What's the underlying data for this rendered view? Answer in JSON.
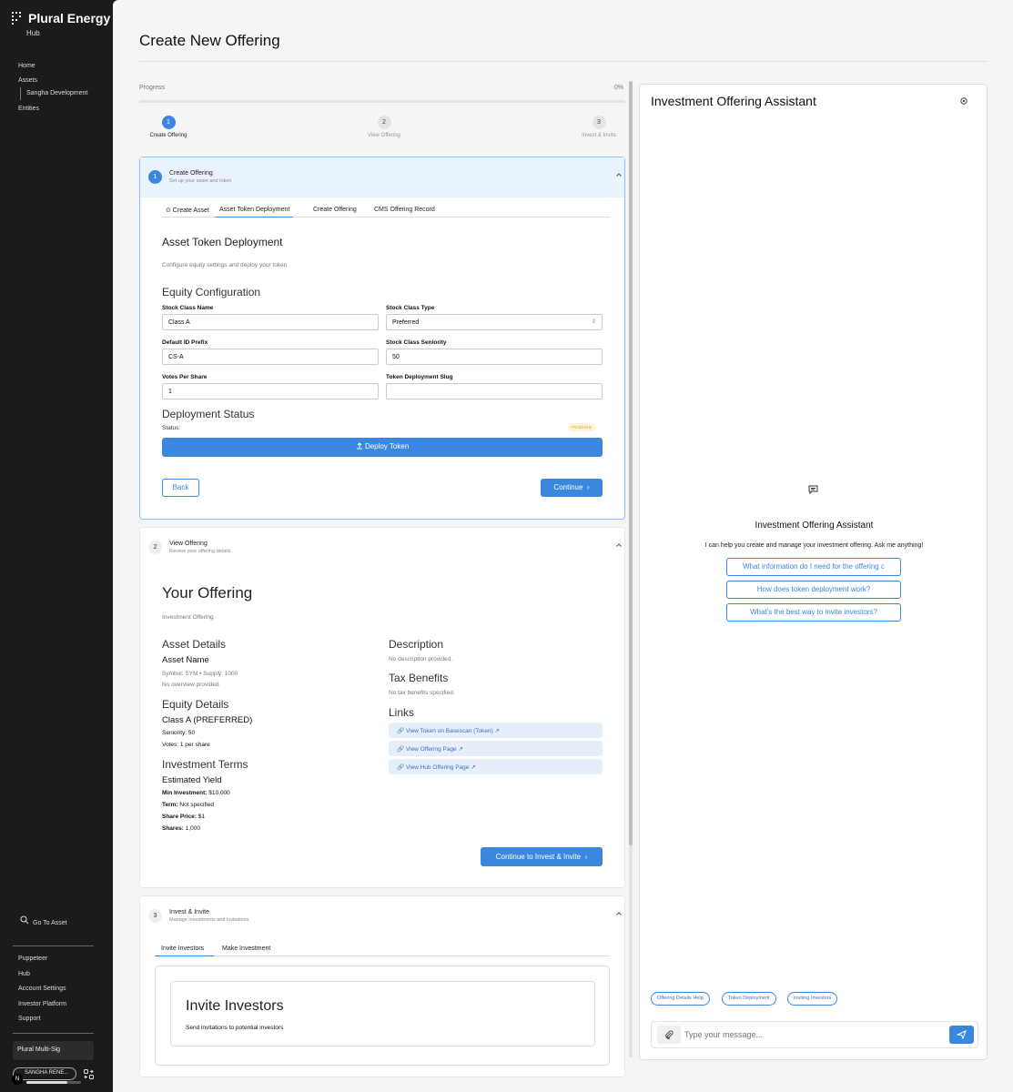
{
  "sidebar": {
    "brand": "Plural Energy",
    "brand_sub": "Hub",
    "nav": {
      "home": "Home",
      "assets": "Assets",
      "asset_child": "Sangha Development",
      "entities": "Entities"
    },
    "goto_asset": "Go To Asset",
    "links": [
      "Puppeteer",
      "Hub",
      "Account Settings",
      "Investor Platform",
      "Support"
    ],
    "multisig": "Plural Multi-Sig",
    "account_initial": "N",
    "account_label": "SANGHA RENE..."
  },
  "page": {
    "title": "Create New Offering"
  },
  "progress": {
    "label": "Progress",
    "percent_text": "0%",
    "fraction": 0
  },
  "steps": [
    {
      "num": "1",
      "label": "Create Offering"
    },
    {
      "num": "2",
      "label": "View Offering"
    },
    {
      "num": "3",
      "label": "Invest & Invite"
    }
  ],
  "section1": {
    "num": "1",
    "title": "Create Offering",
    "subtitle": "Set up your asset and token",
    "tabs": [
      "⊙ Create Asset",
      "Asset Token Deployment",
      "Create Offering",
      "CMS Offering Record"
    ],
    "heading": "Asset Token Deployment",
    "description": "Configure equity settings and deploy your token",
    "equity_heading": "Equity Configuration",
    "fields": {
      "stock_class_name": {
        "label": "Stock Class Name",
        "value": "Class A"
      },
      "stock_class_type": {
        "label": "Stock Class Type",
        "value": "Preferred"
      },
      "default_id_prefix": {
        "label": "Default ID Prefix",
        "value": "CS-A"
      },
      "stock_class_seniority": {
        "label": "Stock Class Seniority",
        "value": "50"
      },
      "votes_per_share": {
        "label": "Votes Per Share",
        "value": "1"
      },
      "token_deployment_slug": {
        "label": "Token Deployment Slug",
        "value": ""
      }
    },
    "deployment_heading": "Deployment Status",
    "status_label": "Status:",
    "status_badge": "PENDING",
    "deploy_button": "Deploy Token",
    "back_button": "Back",
    "continue_button": "Continue"
  },
  "section2": {
    "num": "2",
    "title": "View Offering",
    "subtitle": "Review your offering details",
    "heading": "Your Offering",
    "kind": "Investment Offering",
    "asset_details_heading": "Asset Details",
    "asset_name": "Asset Name",
    "asset_symbol_line": "Symbol: SYM • Supply: 1000",
    "asset_overview": "No overview provided.",
    "equity_heading": "Equity Details",
    "equity_class": "Class A (PREFERRED)",
    "seniority": "Seniority: 50",
    "votes": "Votes: 1 per share",
    "terms_heading": "Investment Terms",
    "yield_label": "Estimated Yield",
    "min_investment_label": "Min Investment:",
    "min_investment_value": " $10,000",
    "term_label": "Term:",
    "term_value": " Not specified",
    "share_price_label": "Share Price:",
    "share_price_value": " $1",
    "shares_label": "Shares:",
    "shares_value": " 1,000",
    "description_heading": "Description",
    "description_text": "No description provided.",
    "tax_heading": "Tax Benefits",
    "tax_text": "No tax benefits specified.",
    "links_heading": "Links",
    "links": [
      "View Token on Basescan (Token)",
      "View Offering Page",
      "View Hub Offering Page"
    ],
    "continue_button": "Continue to Invest & Invite"
  },
  "section3": {
    "num": "3",
    "title": "Invest & Invite",
    "subtitle": "Manage investments and invitations",
    "tabs": [
      "Invite Investors",
      "Make Investment"
    ],
    "invite_heading": "Invite Investors",
    "invite_sub": "Send invitations to potential investors"
  },
  "assistant": {
    "title": "Investment Offering Assistant",
    "heading": "Investment Offering Assistant",
    "intro": "I can help you create and manage your investment offering. Ask me anything!",
    "suggestions": [
      "What information do I need for the offering c",
      "How does token deployment work?",
      "What's the best way to invite investors?"
    ],
    "chips": [
      "Offering Details Help",
      "Token Deployment",
      "Inviting Investors"
    ],
    "input_placeholder": "Type your message..."
  },
  "colors": {
    "accent": "#3a87e0",
    "sidebar_bg": "#1b1b1b",
    "pending": "#e0a31c"
  }
}
